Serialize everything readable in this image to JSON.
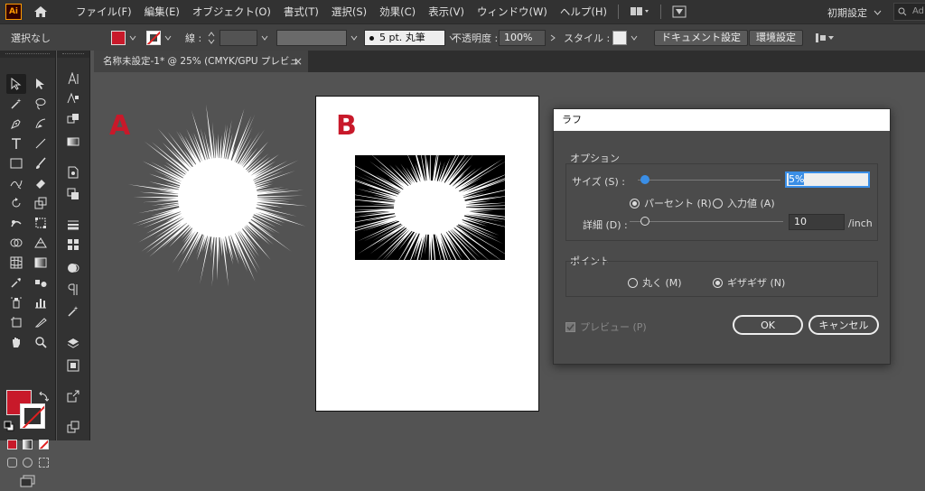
{
  "app": {
    "logo_text": "Ai",
    "menu": [
      "ファイル(F)",
      "編集(E)",
      "オブジェクト(O)",
      "書式(T)",
      "選択(S)",
      "効果(C)",
      "表示(V)",
      "ウィンドウ(W)",
      "ヘルプ(H)"
    ],
    "workspace": "初期設定",
    "search_placeholder": "Ad"
  },
  "control_bar": {
    "selection": "選択なし",
    "stroke_label": "線 :",
    "brush": "5 pt. 丸筆",
    "opacity_label": "不透明度 :",
    "opacity_value": "100%",
    "style_label": "スタイル :",
    "doc_setup": "ドキュメント設定",
    "preferences": "環境設定",
    "fill_color": "#c8192a"
  },
  "document": {
    "tab_title": "名称未設定-1* @ 25% (CMYK/GPU プレビュー)",
    "close": "×"
  },
  "canvas": {
    "label_a": "A",
    "label_b": "B"
  },
  "dialog": {
    "title": "ラフ",
    "options_label": "オプション",
    "size_label": "サイズ (S) :",
    "size_value": "5%",
    "size_level_fraction": 0.05,
    "percent_label": "パーセント (R)",
    "input_label": "入力値 (A)",
    "detail_label": "詳細 (D) :",
    "detail_value": "10",
    "detail_unit": "/inch",
    "detail_level_fraction": 0.1,
    "point_label": "ポイント",
    "smooth_label": "丸く (M)",
    "jagged_label": "ギザギザ (N)",
    "preview_label": "プレビュー (P)",
    "ok": "OK",
    "cancel": "キャンセル"
  }
}
